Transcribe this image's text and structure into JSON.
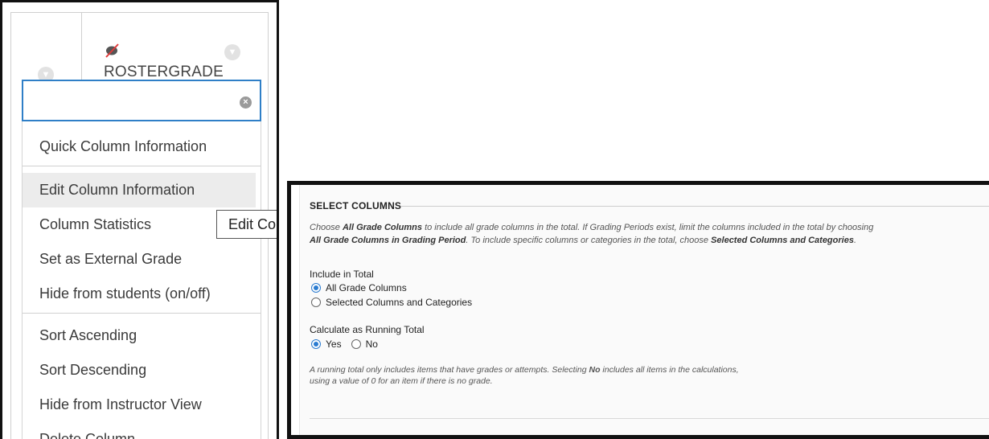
{
  "column_menu": {
    "column_name": "ROSTERGRADE",
    "search": {
      "value": "",
      "placeholder": ""
    },
    "groups": [
      {
        "items": [
          {
            "label": "Quick Column Information"
          }
        ]
      },
      {
        "items": [
          {
            "label": "Edit Column Information",
            "hovered": true
          },
          {
            "label": "Column Statistics"
          },
          {
            "label": "Set as External Grade"
          },
          {
            "label": "Hide from students (on/off)"
          }
        ]
      },
      {
        "items": [
          {
            "label": "Sort Ascending"
          },
          {
            "label": "Sort Descending"
          },
          {
            "label": "Hide from Instructor View"
          },
          {
            "label": "Delete Column"
          }
        ]
      }
    ],
    "tooltip": "Edit Col"
  },
  "select_columns": {
    "title": "SELECT COLUMNS",
    "instructions": {
      "p1": "Choose ",
      "b1": "All Grade Columns",
      "p2": " to include all grade columns in the total. If Grading Periods exist, limit the columns included in the total by choosing",
      "b2": "All Grade Columns in Grading Period",
      "p3": ". To include specific columns or categories in the total, choose ",
      "b3": "Selected Columns and Categories",
      "p4": "."
    },
    "include_in_total": {
      "label": "Include in Total",
      "options": [
        {
          "label": "All Grade Columns",
          "checked": true
        },
        {
          "label": "Selected Columns and Categories",
          "checked": false
        }
      ]
    },
    "running_total": {
      "label": "Calculate as Running Total",
      "yes_label": "Yes",
      "no_label": "No",
      "selected": "Yes",
      "help": {
        "p1": "A running total only includes items that have grades or attempts. Selecting ",
        "b1": "No",
        "p2": " includes all items in the calculations,",
        "p3": "using a value of 0 for an item if there is no grade."
      }
    }
  },
  "colors": {
    "accent": "#2a7bd0",
    "focus_border": "#2f7fc7",
    "hover_bg": "#ececec"
  }
}
